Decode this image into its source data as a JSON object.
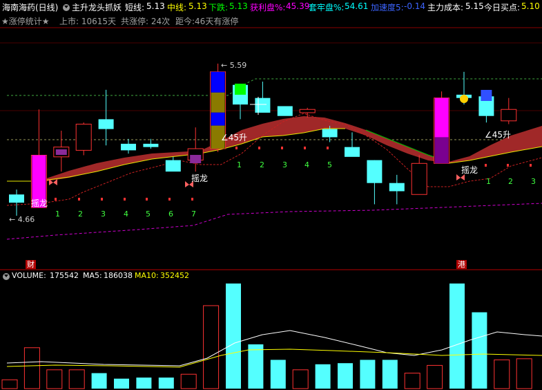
{
  "header": {
    "stock_title": "海南海药(日线)",
    "indicator_name": "主升龙头抓妖",
    "short_label": "短线:",
    "short_value": "5.13",
    "mid_label": "中线:",
    "mid_value": "5.13",
    "down_label": "下跌:",
    "down_value": "5.13",
    "profit_label": "获利盘%:",
    "profit_value": "45.39",
    "trap_label": "套牢盘%:",
    "trap_value": "54.61",
    "accel_label": "加速度5:",
    "accel_value": "-0.14",
    "cost_label": "主力成本:",
    "cost_value": "5.15",
    "buy_label": "今日买点:",
    "buy_value": "5.10"
  },
  "stats": {
    "limit_stats": "★涨停统计★",
    "listed": "上市: 10615天",
    "total_limit": "共涨停: 24次",
    "since": "距今:46天有涨停"
  },
  "annotations": {
    "yaolong": "摇龙",
    "rise45": "∠45升",
    "rise45b": "∠45升",
    "price_high": "5.59",
    "price_low": "4.66",
    "fin_badge": "财",
    "gang_badge": "港"
  },
  "volume_header": {
    "volume_label": "VOLUME:",
    "volume_value": "175542",
    "ma5_label": "MA5:",
    "ma5_value": "186038",
    "ma10_label": "MA10:",
    "ma10_value": "352452"
  },
  "colors": {
    "up": "#ff3232",
    "down": "#54ffff",
    "white": "#ffffff",
    "yellow": "#ffff00",
    "magenta": "#ff00ff"
  },
  "chart_data": {
    "type": "candlestick",
    "price_axis": [
      4.5,
      5.75
    ],
    "candles": [
      {
        "o": 4.79,
        "h": 4.82,
        "l": 4.66,
        "c": 4.74
      },
      {
        "o": 4.71,
        "h": 5.31,
        "l": 4.71,
        "c": 5.03
      },
      {
        "o": 5.02,
        "h": 5.18,
        "l": 4.93,
        "c": 5.08
      },
      {
        "o": 5.06,
        "h": 5.23,
        "l": 5.03,
        "c": 5.22
      },
      {
        "o": 5.25,
        "h": 5.43,
        "l": 5.09,
        "c": 5.19
      },
      {
        "o": 5.1,
        "h": 5.13,
        "l": 5.04,
        "c": 5.06
      },
      {
        "o": 5.1,
        "h": 5.13,
        "l": 5.07,
        "c": 5.08
      },
      {
        "o": 5.0,
        "h": 5.02,
        "l": 4.97,
        "c": 4.93
      },
      {
        "o": 5.0,
        "h": 5.2,
        "l": 4.93,
        "c": 5.07
      },
      {
        "o": 5.07,
        "h": 5.59,
        "l": 5.05,
        "c": 5.54
      },
      {
        "o": 5.46,
        "h": 5.46,
        "l": 5.25,
        "c": 5.34
      },
      {
        "o": 5.38,
        "h": 5.48,
        "l": 5.29,
        "c": 5.29
      },
      {
        "o": 5.33,
        "h": 5.33,
        "l": 5.29,
        "c": 5.27
      },
      {
        "o": 5.29,
        "h": 5.32,
        "l": 5.26,
        "c": 5.31
      },
      {
        "o": 5.19,
        "h": 5.21,
        "l": 5.11,
        "c": 5.14
      },
      {
        "o": 5.08,
        "h": 5.17,
        "l": 5.06,
        "c": 5.02
      },
      {
        "o": 5.0,
        "h": 5.0,
        "l": 4.73,
        "c": 4.86
      },
      {
        "o": 4.86,
        "h": 4.91,
        "l": 4.73,
        "c": 4.81
      },
      {
        "o": 4.79,
        "h": 5.03,
        "l": 4.79,
        "c": 4.98
      },
      {
        "o": 4.98,
        "h": 5.42,
        "l": 4.98,
        "c": 5.38
      },
      {
        "o": 5.4,
        "h": 5.54,
        "l": 5.34,
        "c": 5.38
      },
      {
        "o": 5.39,
        "h": 5.41,
        "l": 5.23,
        "c": 5.27
      },
      {
        "o": 5.24,
        "h": 5.38,
        "l": 5.22,
        "c": 5.31
      }
    ],
    "volume": [
      8000,
      37000,
      17000,
      17000,
      14000,
      9000,
      10000,
      10000,
      13000,
      75000,
      95000,
      40000,
      26000,
      17000,
      22000,
      23000,
      26000,
      26000,
      14000,
      21000,
      95000,
      69000,
      26000,
      27000
    ],
    "signal_numbers": [
      "1",
      "2",
      "3",
      "4",
      "5",
      "6",
      "7",
      "1",
      "2",
      "3",
      "4",
      "5",
      "1",
      "2",
      "3"
    ]
  }
}
